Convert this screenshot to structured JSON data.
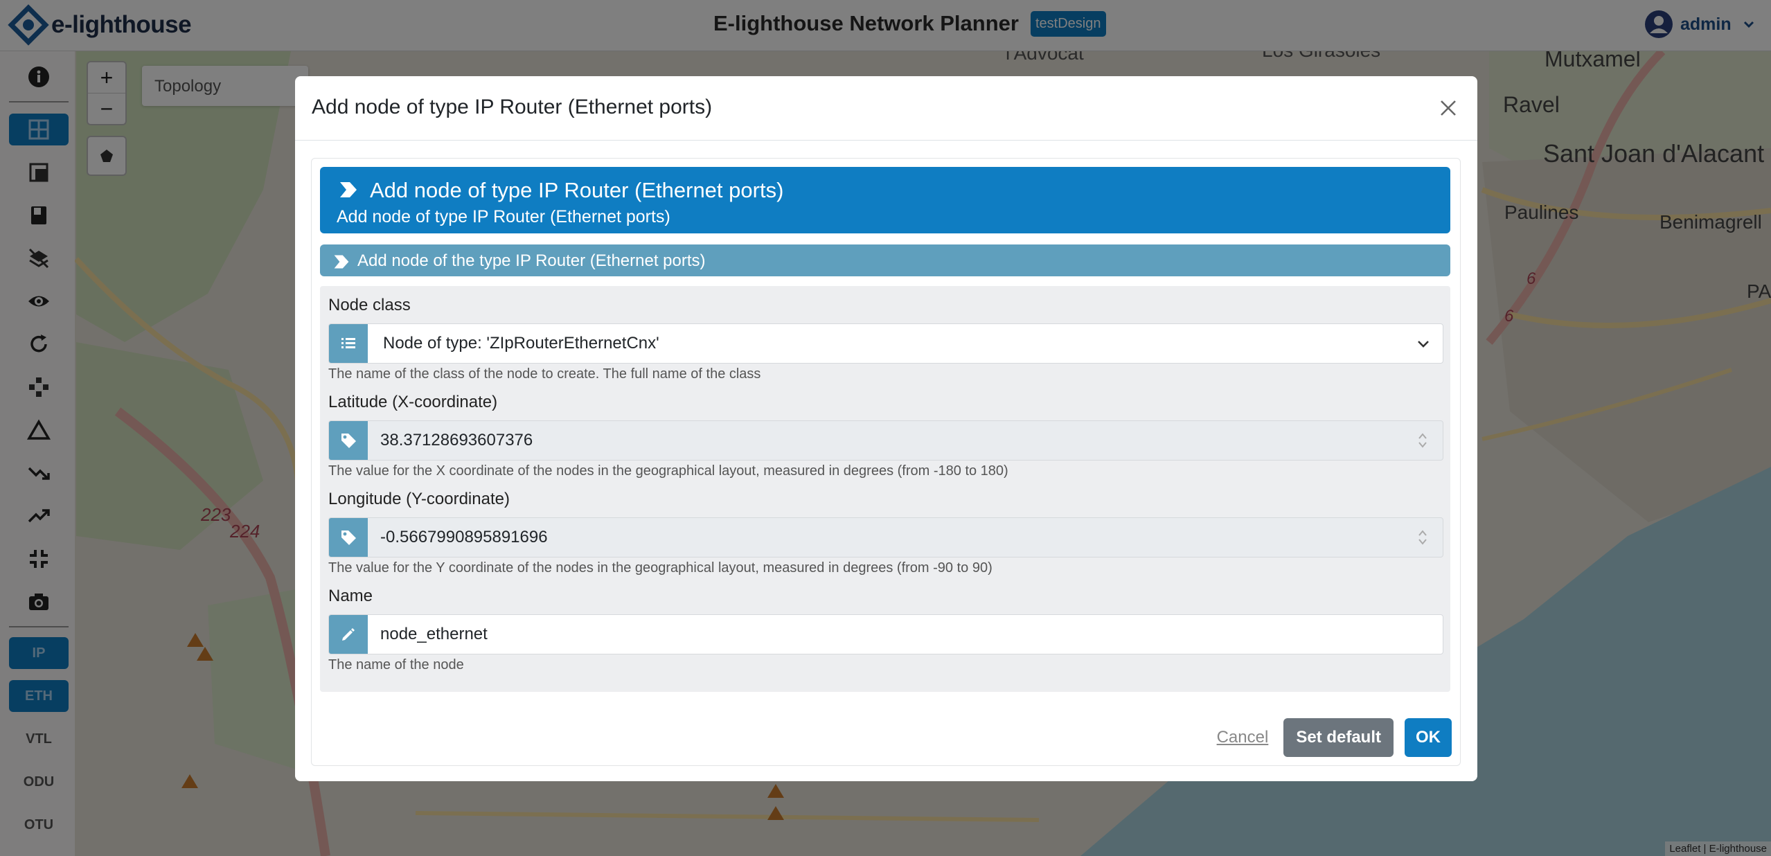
{
  "header": {
    "logo_text": "e-lighthouse",
    "title": "E-lighthouse Network Planner",
    "design_badge": "testDesign",
    "user_name": "admin"
  },
  "map": {
    "topology_label": "Topology",
    "attribution": "Leaflet | E-lighthouse",
    "place_labels": [
      "l'Advocat",
      "Los Girasoles",
      "Mutxamel",
      "Ravel",
      "Sant Joan d'Alacant",
      "Paulines",
      "Benimagrell",
      "PA"
    ],
    "road_labels": [
      "223",
      "224",
      "6",
      "6"
    ],
    "colors": {
      "land": "#e7e3d9",
      "sea": "#abd3de",
      "green": "#cbe0b4",
      "roads_major": "#e8b0a8",
      "roads_minor": "#f7dfa0"
    }
  },
  "sidebar": {
    "icons": [
      "info-icon",
      "grid-view-icon",
      "layers-icon",
      "book-icon",
      "layers-off-icon",
      "eye-icon",
      "refresh-icon",
      "network-icon",
      "triangle-icon",
      "trend-down-icon",
      "trend-up-icon",
      "fit-screen-icon",
      "camera-icon"
    ],
    "layers": [
      "IP",
      "ETH",
      "VTL",
      "ODU",
      "OTU"
    ],
    "active_layers": [
      "IP",
      "ETH"
    ]
  },
  "modal": {
    "title": "Add node of type IP Router (Ethernet ports)",
    "banner_title": "Add node of type IP Router (Ethernet ports)",
    "banner_subtitle": "Add node of type IP Router (Ethernet ports)",
    "section_title": "Add node of the type IP Router (Ethernet ports)",
    "fields": {
      "node_class": {
        "label": "Node class",
        "value": "Node of type: 'ZIpRouterEthernetCnx'",
        "help": "The name of the class of the node to create. The full name of the class"
      },
      "latitude": {
        "label": "Latitude (X-coordinate)",
        "value": "38.37128693607376",
        "help": "The value for the X coordinate of the nodes in the geographical layout, measured in degrees (from -180 to 180)"
      },
      "longitude": {
        "label": "Longitude (Y-coordinate)",
        "value": "-0.5667990895891696",
        "help": "The value for the Y coordinate of the nodes in the geographical layout, measured in degrees (from -90 to 90)"
      },
      "name": {
        "label": "Name",
        "value": "node_ethernet",
        "help": "The name of the node"
      }
    },
    "buttons": {
      "cancel": "Cancel",
      "set_default": "Set default",
      "ok": "OK"
    },
    "accent_color": "#0f7dc2",
    "secondary_color": "#5f9fbd"
  }
}
